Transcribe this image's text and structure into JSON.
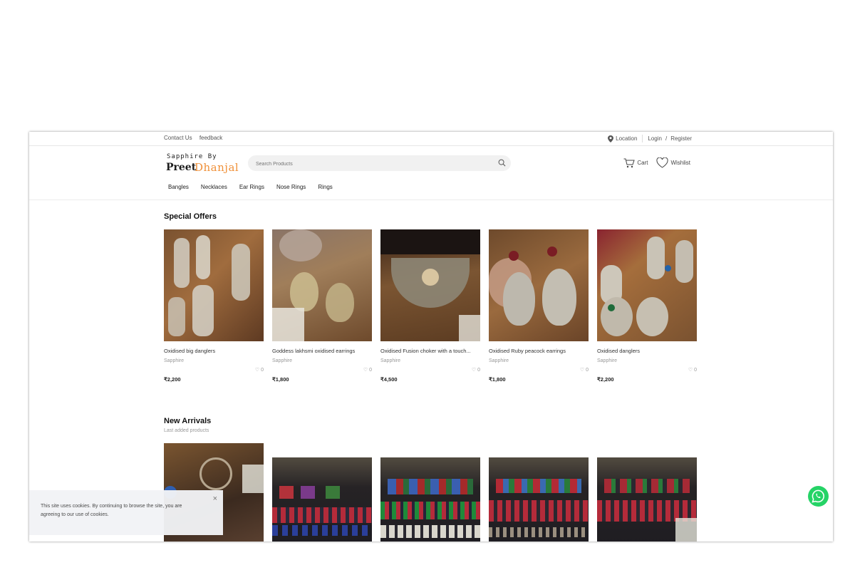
{
  "topbar": {
    "contact_label": "Contact Us",
    "feedback_label": "feedback",
    "location_label": "Location",
    "login_label": "Login",
    "slash": "/",
    "register_label": "Register"
  },
  "logo": {
    "line1": "Sapphire By",
    "line2": "Preet",
    "line3": "Dhanjal"
  },
  "search": {
    "placeholder": "Search Products"
  },
  "actions": {
    "cart_label": "Cart",
    "wishlist_label": "Wishlist"
  },
  "nav": [
    "Bangles",
    "Necklaces",
    "Ear Rings",
    "Nose Rings",
    "Rings"
  ],
  "special_offers": {
    "title": "Special Offers",
    "products": [
      {
        "name": "Oxidised big danglers",
        "brand": "Sapphire",
        "likes": "0",
        "price": "₹2,200"
      },
      {
        "name": "Goddess lakhsmi oxidised earrings",
        "brand": "Sapphire",
        "likes": "0",
        "price": "₹1,800"
      },
      {
        "name": "Oxidised Fusion choker with a touch...",
        "brand": "Sapphire",
        "likes": "0",
        "price": "₹4,500"
      },
      {
        "name": "Oxidised Ruby peacock earrings",
        "brand": "Sapphire",
        "likes": "0",
        "price": "₹1,800"
      },
      {
        "name": "Oxidised danglers",
        "brand": "Sapphire",
        "likes": "0",
        "price": "₹2,200"
      }
    ]
  },
  "new_arrivals": {
    "title": "New Arrivals",
    "subtitle": "Last added products"
  },
  "cookie": {
    "text": "This site uses cookies. By continuing to browse the site, you are agreeing to our use of cookies.",
    "close_symbol": "×"
  },
  "colors": {
    "accent": "#f0913a",
    "whatsapp": "#25d366"
  }
}
